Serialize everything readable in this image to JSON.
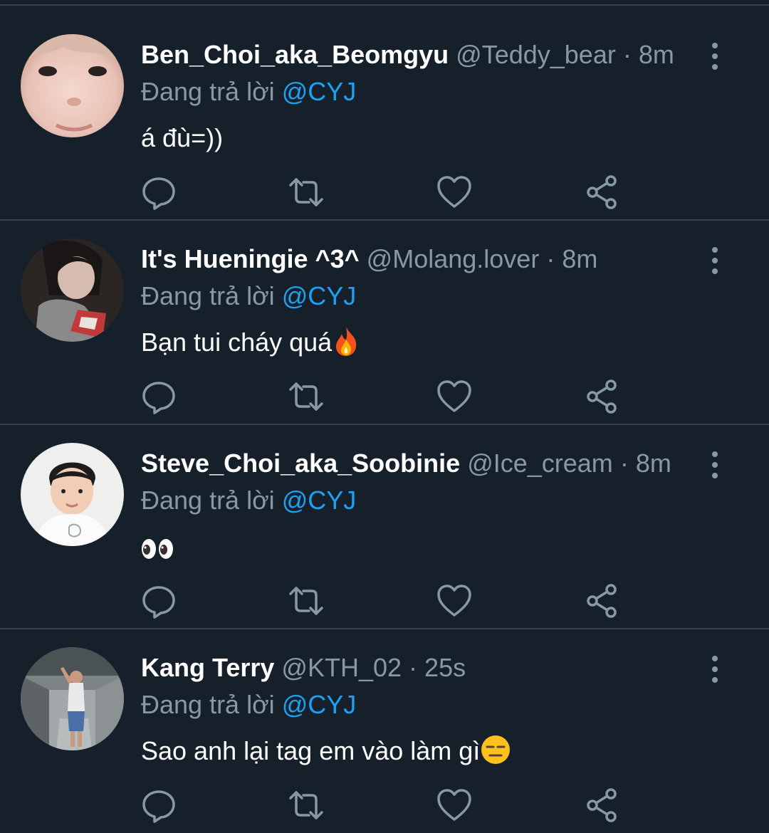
{
  "tweets": [
    {
      "name": "Ben_Choi_aka_Beomgyu",
      "handle": "@Teddy_bear",
      "time": "8m",
      "reply_prefix": "Đang trả lời",
      "reply_to": "@CYJ",
      "text": "á đù=))",
      "emoji": ""
    },
    {
      "name": "It's Hueningie ^3^",
      "handle": "@Molang.lover",
      "time": "8m",
      "reply_prefix": "Đang trả lời",
      "reply_to": "@CYJ",
      "text": "Bạn tui cháy quá",
      "emoji": "fire-emoji"
    },
    {
      "name": "Steve_Choi_aka_Soobinie",
      "handle": "@Ice_cream",
      "time": "8m",
      "reply_prefix": "Đang trả lời",
      "reply_to": "@CYJ",
      "text": "",
      "emoji": "eyes-emoji"
    },
    {
      "name": "Kang Terry",
      "handle": "@KTH_02",
      "time": "25s",
      "reply_prefix": "Đang trả lời",
      "reply_to": "@CYJ",
      "text": "Sao anh lại tag em vào làm gì",
      "emoji": "expressionless-face-emoji"
    }
  ],
  "separator": "·",
  "icons": {
    "reply": "reply-icon",
    "retweet": "retweet-icon",
    "like": "heart-icon",
    "share": "share-icon",
    "more": "more-vertical-icon"
  },
  "colors": {
    "background": "#15202b",
    "divider": "#38444d",
    "name": "#ffffff",
    "muted": "#8899a6",
    "link": "#1da1f2"
  }
}
